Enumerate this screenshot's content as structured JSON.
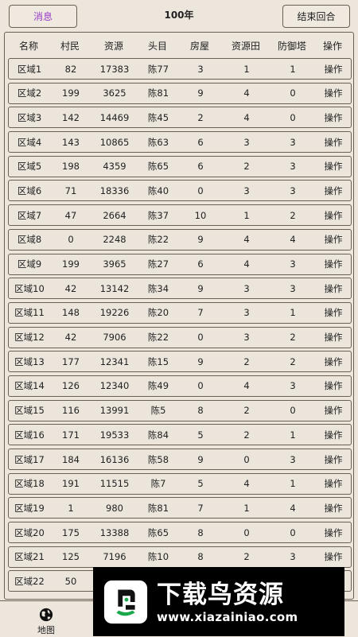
{
  "topbar": {
    "message_label": "消息",
    "year_label": "100年",
    "end_turn_label": "结束回合"
  },
  "table": {
    "columns": [
      "名称",
      "村民",
      "资源",
      "头目",
      "房屋",
      "资源田",
      "防御塔",
      "操作"
    ],
    "rows": [
      [
        "区域1",
        "82",
        "17383",
        "陈77",
        "3",
        "1",
        "1",
        "操作"
      ],
      [
        "区域2",
        "199",
        "3625",
        "陈81",
        "9",
        "4",
        "0",
        "操作"
      ],
      [
        "区域3",
        "142",
        "14469",
        "陈45",
        "2",
        "4",
        "0",
        "操作"
      ],
      [
        "区域4",
        "143",
        "10865",
        "陈63",
        "6",
        "3",
        "3",
        "操作"
      ],
      [
        "区域5",
        "198",
        "4359",
        "陈65",
        "6",
        "2",
        "3",
        "操作"
      ],
      [
        "区域6",
        "71",
        "18336",
        "陈40",
        "0",
        "3",
        "3",
        "操作"
      ],
      [
        "区域7",
        "47",
        "2664",
        "陈37",
        "10",
        "1",
        "2",
        "操作"
      ],
      [
        "区域8",
        "0",
        "2248",
        "陈22",
        "9",
        "4",
        "4",
        "操作"
      ],
      [
        "区域9",
        "199",
        "3965",
        "陈27",
        "6",
        "4",
        "3",
        "操作"
      ],
      [
        "区域10",
        "42",
        "13142",
        "陈34",
        "9",
        "3",
        "3",
        "操作"
      ],
      [
        "区域11",
        "148",
        "19226",
        "陈20",
        "7",
        "3",
        "1",
        "操作"
      ],
      [
        "区域12",
        "42",
        "7906",
        "陈22",
        "0",
        "3",
        "2",
        "操作"
      ],
      [
        "区域13",
        "177",
        "12341",
        "陈15",
        "9",
        "2",
        "2",
        "操作"
      ],
      [
        "区域14",
        "126",
        "12340",
        "陈49",
        "0",
        "4",
        "3",
        "操作"
      ],
      [
        "区域15",
        "116",
        "13991",
        "陈5",
        "8",
        "2",
        "0",
        "操作"
      ],
      [
        "区域16",
        "171",
        "19533",
        "陈84",
        "5",
        "2",
        "1",
        "操作"
      ],
      [
        "区域17",
        "184",
        "16136",
        "陈58",
        "9",
        "0",
        "3",
        "操作"
      ],
      [
        "区域18",
        "191",
        "11515",
        "陈7",
        "5",
        "4",
        "1",
        "操作"
      ],
      [
        "区域19",
        "1",
        "980",
        "陈81",
        "7",
        "1",
        "4",
        "操作"
      ],
      [
        "区域20",
        "175",
        "13388",
        "陈65",
        "8",
        "0",
        "0",
        "操作"
      ],
      [
        "区域21",
        "125",
        "7196",
        "陈10",
        "8",
        "2",
        "3",
        "操作"
      ],
      [
        "区域22",
        "50",
        "",
        "",
        "",
        "",
        "",
        ""
      ]
    ]
  },
  "bottom_nav": {
    "map_label": "地图",
    "map_icon": "globe-icon"
  },
  "watermark": {
    "title": "下载鸟资源",
    "url": "www.xiazainiao.com",
    "logo_icon": "bird-logo-icon"
  }
}
